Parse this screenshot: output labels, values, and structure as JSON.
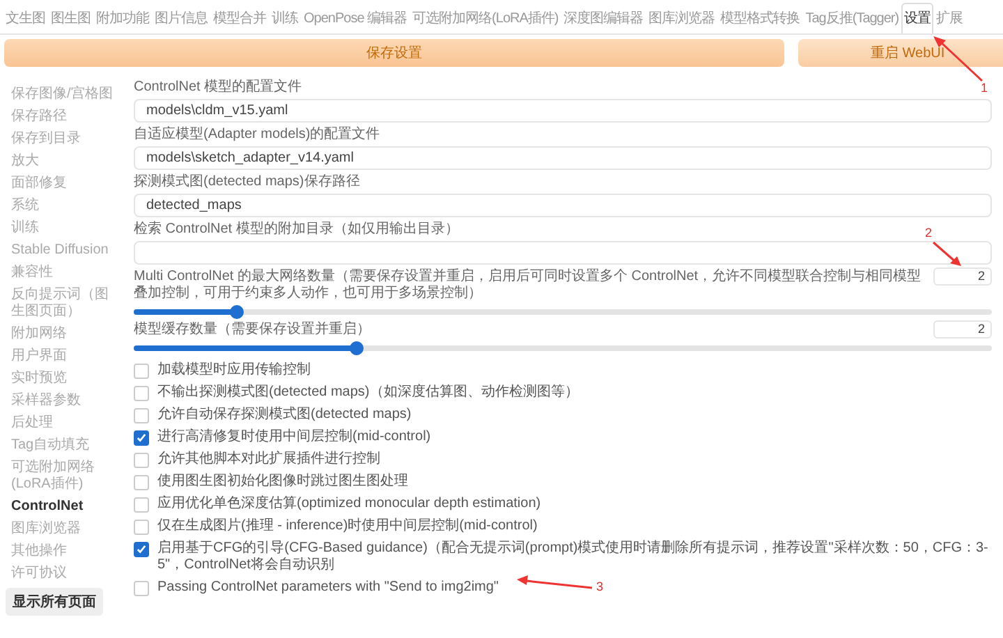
{
  "tabs": [
    {
      "label": "文生图",
      "selected": false
    },
    {
      "label": "图生图",
      "selected": false
    },
    {
      "label": "附加功能",
      "selected": false
    },
    {
      "label": "图片信息",
      "selected": false
    },
    {
      "label": "模型合并",
      "selected": false
    },
    {
      "label": "训练",
      "selected": false
    },
    {
      "label": "OpenPose 编辑器",
      "selected": false
    },
    {
      "label": "可选附加网络(LoRA插件)",
      "selected": false
    },
    {
      "label": "深度图编辑器",
      "selected": false
    },
    {
      "label": "图库浏览器",
      "selected": false
    },
    {
      "label": "模型格式转换",
      "selected": false
    },
    {
      "label": "Tag反推(Tagger)",
      "selected": false
    },
    {
      "label": "设置",
      "selected": true
    },
    {
      "label": "扩展",
      "selected": false
    }
  ],
  "actions": {
    "save": "保存设置",
    "restart": "重启 WebUI"
  },
  "sidebar": {
    "items": [
      {
        "label": "保存图像/宫格图",
        "selected": false
      },
      {
        "label": "保存路径",
        "selected": false
      },
      {
        "label": "保存到目录",
        "selected": false
      },
      {
        "label": "放大",
        "selected": false
      },
      {
        "label": "面部修复",
        "selected": false
      },
      {
        "label": "系统",
        "selected": false
      },
      {
        "label": "训练",
        "selected": false
      },
      {
        "label": "Stable Diffusion",
        "selected": false
      },
      {
        "label": "兼容性",
        "selected": false
      },
      {
        "label": "反向提示词（图生图页面）",
        "selected": false
      },
      {
        "label": "附加网络",
        "selected": false
      },
      {
        "label": "用户界面",
        "selected": false
      },
      {
        "label": "实时预览",
        "selected": false
      },
      {
        "label": "采样器参数",
        "selected": false
      },
      {
        "label": "后处理",
        "selected": false
      },
      {
        "label": "Tag自动填充",
        "selected": false
      },
      {
        "label": "可选附加网络(LoRA插件)",
        "selected": false
      },
      {
        "label": "ControlNet",
        "selected": true
      },
      {
        "label": "图库浏览器",
        "selected": false
      },
      {
        "label": "其他操作",
        "selected": false
      },
      {
        "label": "许可协议",
        "selected": false
      }
    ],
    "show_all": "显示所有页面"
  },
  "settings": [
    {
      "kind": "text",
      "label": "ControlNet 模型的配置文件",
      "value": "models\\cldm_v15.yaml"
    },
    {
      "kind": "text",
      "label": "自适应模型(Adapter models)的配置文件",
      "value": "models\\sketch_adapter_v14.yaml"
    },
    {
      "kind": "text",
      "label": "探测模式图(detected maps)保存路径",
      "value": "detected_maps"
    },
    {
      "kind": "text",
      "label": "检索 ControlNet 模型的附加目录（如仅用输出目录）"
    },
    {
      "kind": "slider",
      "label": "Multi ControlNet 的最大网络数量（需要保存设置并重启，启用后可同时设置多个 ControlNet，允许不同模型联合控制与相同模型叠加控制，可用于约束多人动作，也可用于多场景控制）",
      "value": "2",
      "level": 0.12
    },
    {
      "kind": "slider",
      "label": "模型缓存数量（需要保存设置并重启）",
      "value": "2",
      "level": 0.26
    },
    {
      "kind": "checkbox",
      "label": "加载模型时应用传输控制",
      "checked": false
    },
    {
      "kind": "checkbox",
      "label": "不输出探测模式图(detected maps)（如深度估算图、动作检测图等）",
      "checked": false
    },
    {
      "kind": "checkbox",
      "label": "允许自动保存探测模式图(detected maps)",
      "checked": false
    },
    {
      "kind": "checkbox",
      "label": "进行高清修复时使用中间层控制(mid-control)",
      "checked": true
    },
    {
      "kind": "checkbox",
      "label": "允许其他脚本对此扩展插件进行控制",
      "checked": false
    },
    {
      "kind": "checkbox",
      "label": "使用图生图初始化图像时跳过图生图处理",
      "checked": false
    },
    {
      "kind": "checkbox",
      "label": "应用优化单色深度估算(optimized monocular depth estimation)",
      "checked": false
    },
    {
      "kind": "checkbox",
      "label": "仅在生成图片(推理 - inference)时使用中间层控制(mid-control)",
      "checked": false
    },
    {
      "kind": "checkbox",
      "label": "启用基于CFG的引导(CFG-Based guidance)（配合无提示词(prompt)模式使用时请删除所有提示词，推荐设置\"采样次数：50，CFG：3-5\"，ControlNet将会自动识别",
      "checked": true
    },
    {
      "kind": "checkbox",
      "label": "Passing ControlNet parameters with \"Send to img2img\"",
      "checked": false
    }
  ],
  "annotations": [
    {
      "label": "1"
    },
    {
      "label": "2"
    },
    {
      "label": "3"
    }
  ]
}
